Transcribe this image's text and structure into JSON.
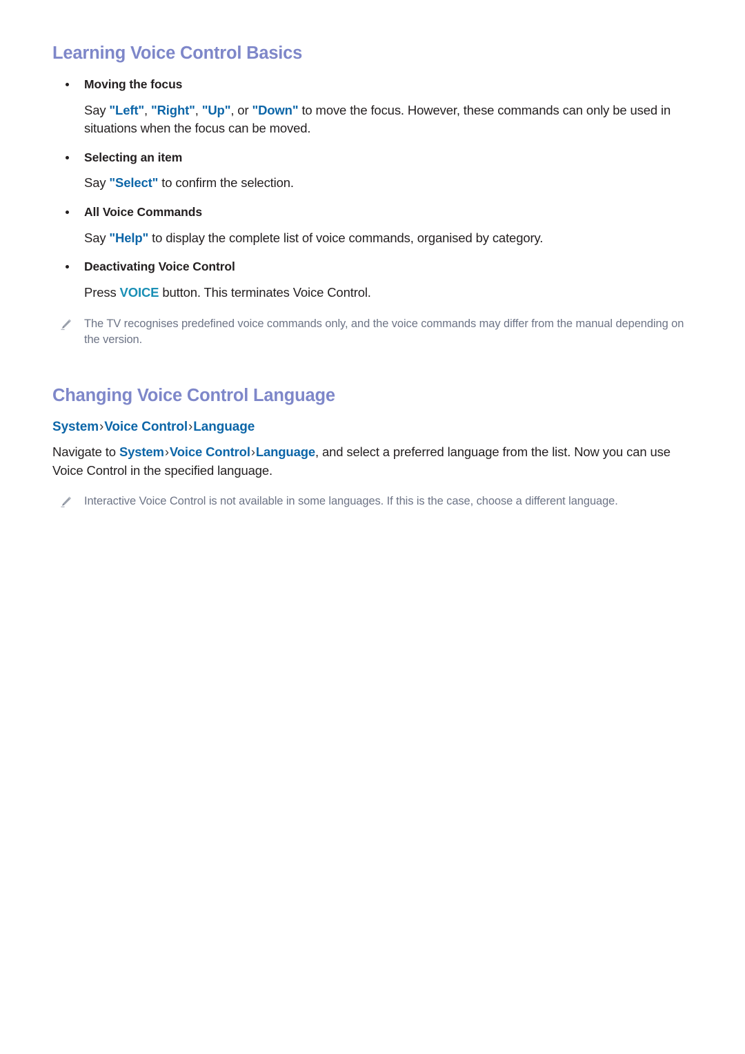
{
  "document": {
    "sections": [
      {
        "id": "learning-voice-control-basics",
        "title": "Learning Voice Control Basics",
        "bullets": [
          {
            "label": "Moving the focus",
            "body_prefix": "Say ",
            "keywords": [
              "\"Left\"",
              "\"Right\"",
              "\"Up\"",
              "\"Down\""
            ],
            "sep1": ", ",
            "sep2": ", ",
            "sep3": ", or ",
            "body_suffix": " to move the focus. However, these commands can only be used in situations when the focus can be moved."
          },
          {
            "label": "Selecting an item",
            "body_prefix": "Say ",
            "keyword": "\"Select\"",
            "body_suffix": " to confirm the selection."
          },
          {
            "label": "All Voice Commands",
            "body_prefix": "Say ",
            "keyword": "\"Help\"",
            "body_suffix": " to display the complete list of voice commands, organised by category."
          },
          {
            "label": "Deactivating Voice Control",
            "body_prefix": "Press ",
            "keyword": "VOICE",
            "body_suffix": " button. This terminates Voice Control."
          }
        ],
        "note": "The TV recognises predefined voice commands only, and the voice commands may differ from the manual depending on the version."
      },
      {
        "id": "changing-voice-control-language",
        "title": "Changing Voice Control Language",
        "breadcrumb": {
          "items": [
            "System",
            "Voice Control",
            "Language"
          ],
          "separator": "›"
        },
        "paragraph": {
          "prefix": "Navigate to ",
          "path": [
            "System",
            "Voice Control",
            "Language"
          ],
          "separator": "›",
          "suffix": ", and select a preferred language from the list. Now you can use Voice Control in the specified language."
        },
        "note": "Interactive Voice Control is not available in some languages. If this is the case, choose a different language."
      }
    ]
  },
  "colors": {
    "heading": "#7e87c9",
    "keyword_blue": "#0d66a8",
    "voice_teal": "#1a8fb5",
    "note_gray": "#6d7486",
    "body": "#231f20",
    "background": "#ffffff"
  },
  "icons": {
    "note": "pencil-icon",
    "breadcrumb_separator": "chevron-right-icon"
  }
}
